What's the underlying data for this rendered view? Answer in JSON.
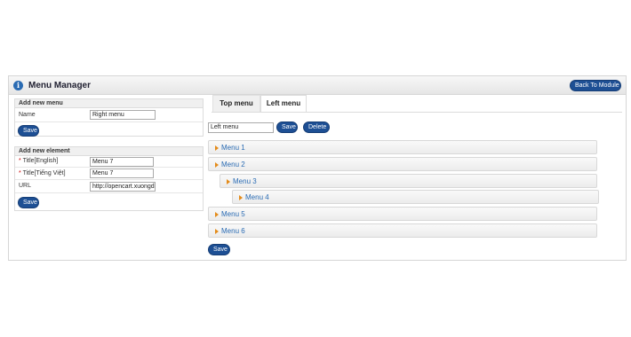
{
  "header": {
    "title": "Menu Manager",
    "icon": "info-icon",
    "back_label": "Back To Module"
  },
  "add_menu": {
    "title": "Add new menu",
    "name_label": "Name",
    "name_value": "Right menu",
    "save_label": "Save"
  },
  "add_element": {
    "title": "Add new element",
    "fields": [
      {
        "required": "*",
        "label": "Title[English]",
        "value": "Menu 7"
      },
      {
        "required": "*",
        "label": "Title[Tiếng Việt]",
        "value": "Menu 7"
      },
      {
        "required": "",
        "label": "URL",
        "value": "http://opencart.xuongda"
      }
    ],
    "save_label": "Save"
  },
  "tabs": [
    {
      "label": "Top menu",
      "active": false
    },
    {
      "label": "Left menu",
      "active": true
    }
  ],
  "menu_editor": {
    "name_value": "Left menu",
    "save_label": "Save",
    "delete_label": "Delete",
    "items": [
      {
        "label": "Menu 1",
        "level": 0
      },
      {
        "label": "Menu 2",
        "level": 0
      },
      {
        "label": "Menu 3",
        "level": 1
      },
      {
        "label": "Menu 4",
        "level": 2
      },
      {
        "label": "Menu 5",
        "level": 0
      },
      {
        "label": "Menu 6",
        "level": 0
      }
    ],
    "bottom_save_label": "Save"
  },
  "colors": {
    "button": "#1d4f94",
    "link": "#2a6bb3",
    "arrow": "#e38b1a",
    "required": "#cc0000"
  }
}
